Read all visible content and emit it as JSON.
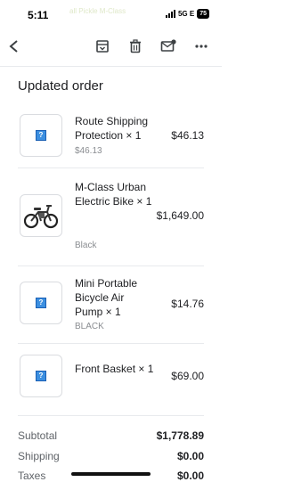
{
  "status": {
    "time": "5:11",
    "network": "5G E",
    "battery": "75",
    "banner": "all Pickle M-Class"
  },
  "section_title": "Updated order",
  "items": [
    {
      "name": "Route Shipping Protection ×  1",
      "sub": "$46.13",
      "price": "$46.13"
    },
    {
      "name": "M-Class Urban Electric Bike ×  1",
      "sub": "Black",
      "price": "$1,649.00"
    },
    {
      "name": "Mini Portable Bicycle Air Pump ×  1",
      "sub": "BLACK",
      "price": "$14.76"
    },
    {
      "name": "Front Basket ×  1",
      "sub": "",
      "price": "$69.00"
    }
  ],
  "totals": [
    {
      "label": "Subtotal",
      "value": "$1,778.89"
    },
    {
      "label": "Shipping",
      "value": "$0.00"
    },
    {
      "label": "Taxes",
      "value": "$0.00"
    }
  ],
  "placeholder_glyph": "?",
  "icons": {
    "back": "back-arrow-icon",
    "archive": "archive-icon",
    "delete": "trash-icon",
    "mark_unread": "mark-unread-icon",
    "more": "more-options-icon"
  },
  "colors": {
    "text": "#202124",
    "muted": "#8a8d91",
    "divider": "#e8eaed"
  }
}
